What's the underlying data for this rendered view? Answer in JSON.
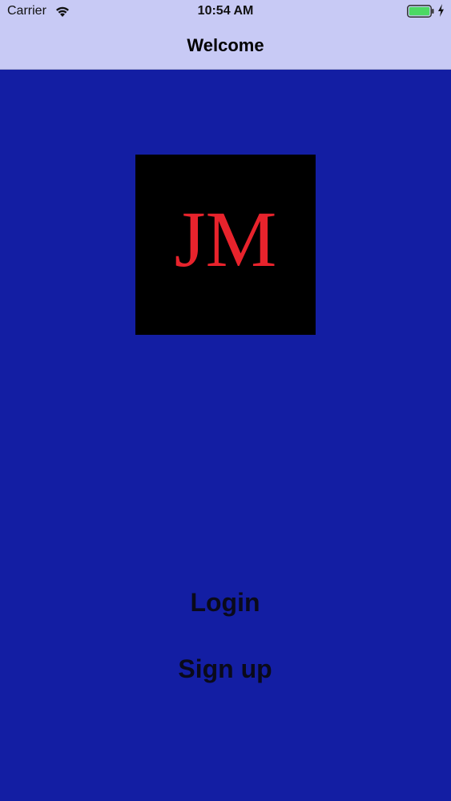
{
  "status_bar": {
    "carrier": "Carrier",
    "time": "10:54 AM",
    "icons": [
      "wifi-icon",
      "battery-icon",
      "charging-bolt-icon"
    ],
    "battery_color": "#4cd964"
  },
  "nav": {
    "title": "Welcome",
    "background_color": "#c8caf5"
  },
  "logo": {
    "text": "JM",
    "text_color": "#e8232c",
    "background_color": "#000000"
  },
  "actions": {
    "login_label": "Login",
    "signup_label": "Sign up"
  },
  "screen": {
    "background_color": "#131ea3"
  }
}
